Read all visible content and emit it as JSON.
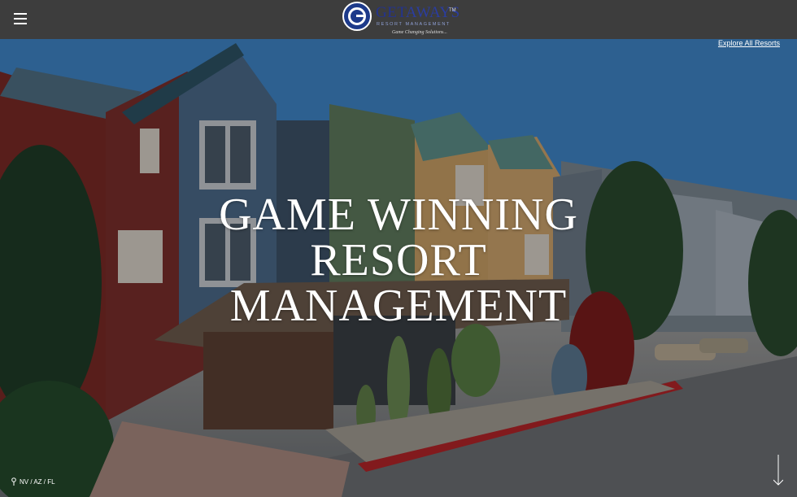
{
  "header": {
    "logo": {
      "name_get": "GET",
      "name_aways": "AWAYS",
      "tm": "TM",
      "subtitle": "RESORT MANAGEMENT",
      "tagline": "Game Changing Solutions..."
    }
  },
  "hero": {
    "explore_link": "Explore All Resorts",
    "headline_lines": [
      "GAME WINNING",
      "RESORT",
      "MANAGEMENT"
    ],
    "states": "NV / AZ / FL"
  },
  "colors": {
    "topbar": "#3d3d3d",
    "logo_blue": "#23338f",
    "text": "#ffffff"
  }
}
